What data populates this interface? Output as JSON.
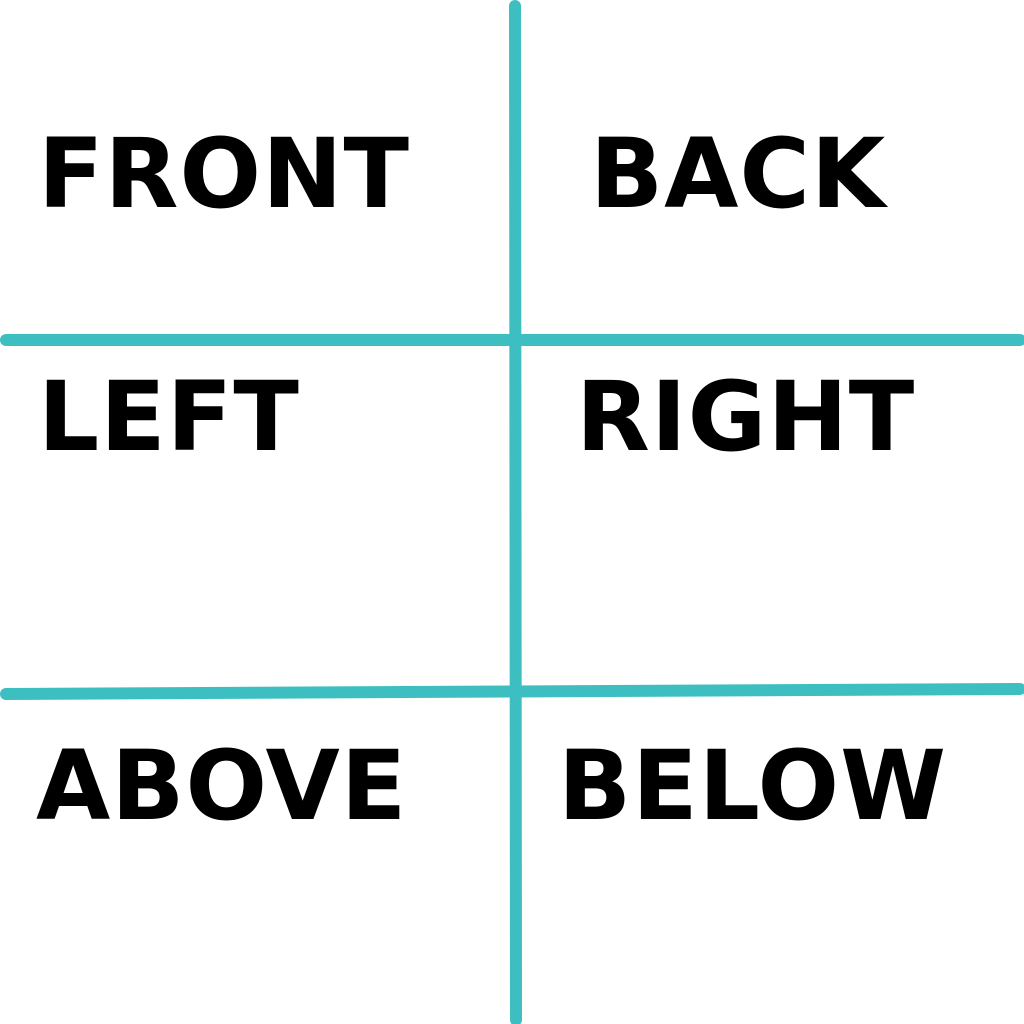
{
  "line_color": "#3dbfc1",
  "text_color": "#000000",
  "cells": [
    {
      "label": "FRONT"
    },
    {
      "label": "BACK"
    },
    {
      "label": "LEFT"
    },
    {
      "label": "RIGHT"
    },
    {
      "label": "ABOVE"
    },
    {
      "label": "BELOW"
    }
  ]
}
